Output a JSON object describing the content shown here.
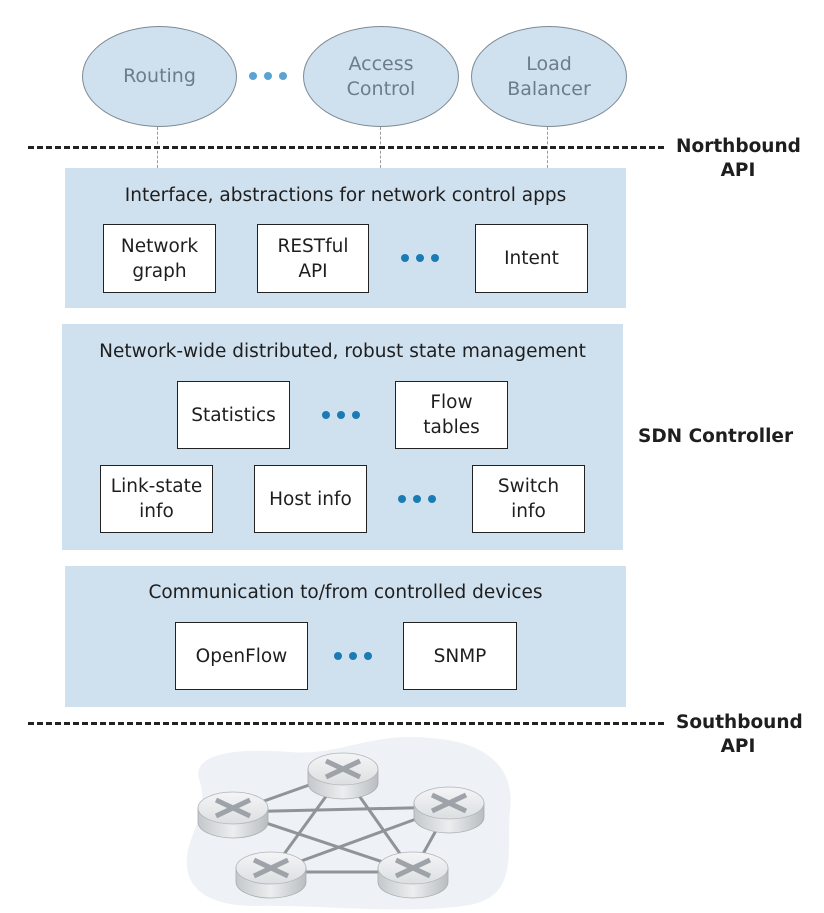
{
  "apps": [
    {
      "label": "Routing"
    },
    {
      "label": "Access\nControl"
    },
    {
      "label": "Load\nBalancer"
    }
  ],
  "northbound_label": "Northbound\nAPI",
  "southbound_label": "Southbound\nAPI",
  "controller_label": "SDN Controller",
  "layers": {
    "interface": {
      "title": "Interface, abstractions for  network control apps",
      "boxes": [
        "Network\ngraph",
        "RESTful\nAPI",
        "Intent"
      ]
    },
    "state": {
      "title": "Network-wide distributed, robust state management",
      "boxes": [
        "Statistics",
        "Flow\ntables",
        "Link-state\ninfo",
        "Host info",
        "Switch\ninfo"
      ]
    },
    "communication": {
      "title": "Communication to/from controlled devices",
      "boxes": [
        "OpenFlow",
        "SNMP"
      ]
    }
  },
  "network": {
    "switch_count": 5,
    "links": [
      [
        0,
        1
      ],
      [
        0,
        2
      ],
      [
        0,
        4
      ],
      [
        1,
        3
      ],
      [
        1,
        4
      ],
      [
        2,
        3
      ],
      [
        2,
        4
      ],
      [
        3,
        4
      ]
    ]
  },
  "colors": {
    "panel": "#cfe0ef",
    "ellipse_fill": "#cfe0ef",
    "dots": "#1a7bb5",
    "dots_light": "#5aa3d3",
    "cloud": "#eef2f6"
  }
}
